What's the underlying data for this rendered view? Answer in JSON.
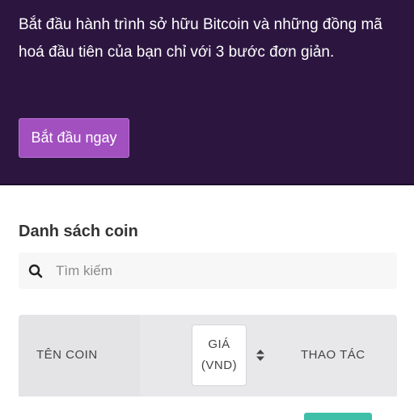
{
  "hero": {
    "description": "Bắt đầu hành trình sở hữu Bitcoin và những đồng mã hoá đầu tiên của bạn chỉ với 3 bước đơn giản.",
    "cta_label": "Bắt đầu ngay"
  },
  "coin_list": {
    "title": "Danh sách coin",
    "search": {
      "placeholder": "Tìm kiếm",
      "value": ""
    },
    "table": {
      "columns": {
        "name": "TÊN COIN",
        "price_line1": "GIÁ",
        "price_line2": "(VND)",
        "action": "THAO TÁC"
      }
    }
  },
  "colors": {
    "hero_bg": "#2c1640",
    "cta_bg": "#a24fc0",
    "header_bg": "#e8e8eb",
    "action_accent": "#3fbfa8"
  },
  "icons": [
    "search-icon",
    "sort-icon"
  ]
}
